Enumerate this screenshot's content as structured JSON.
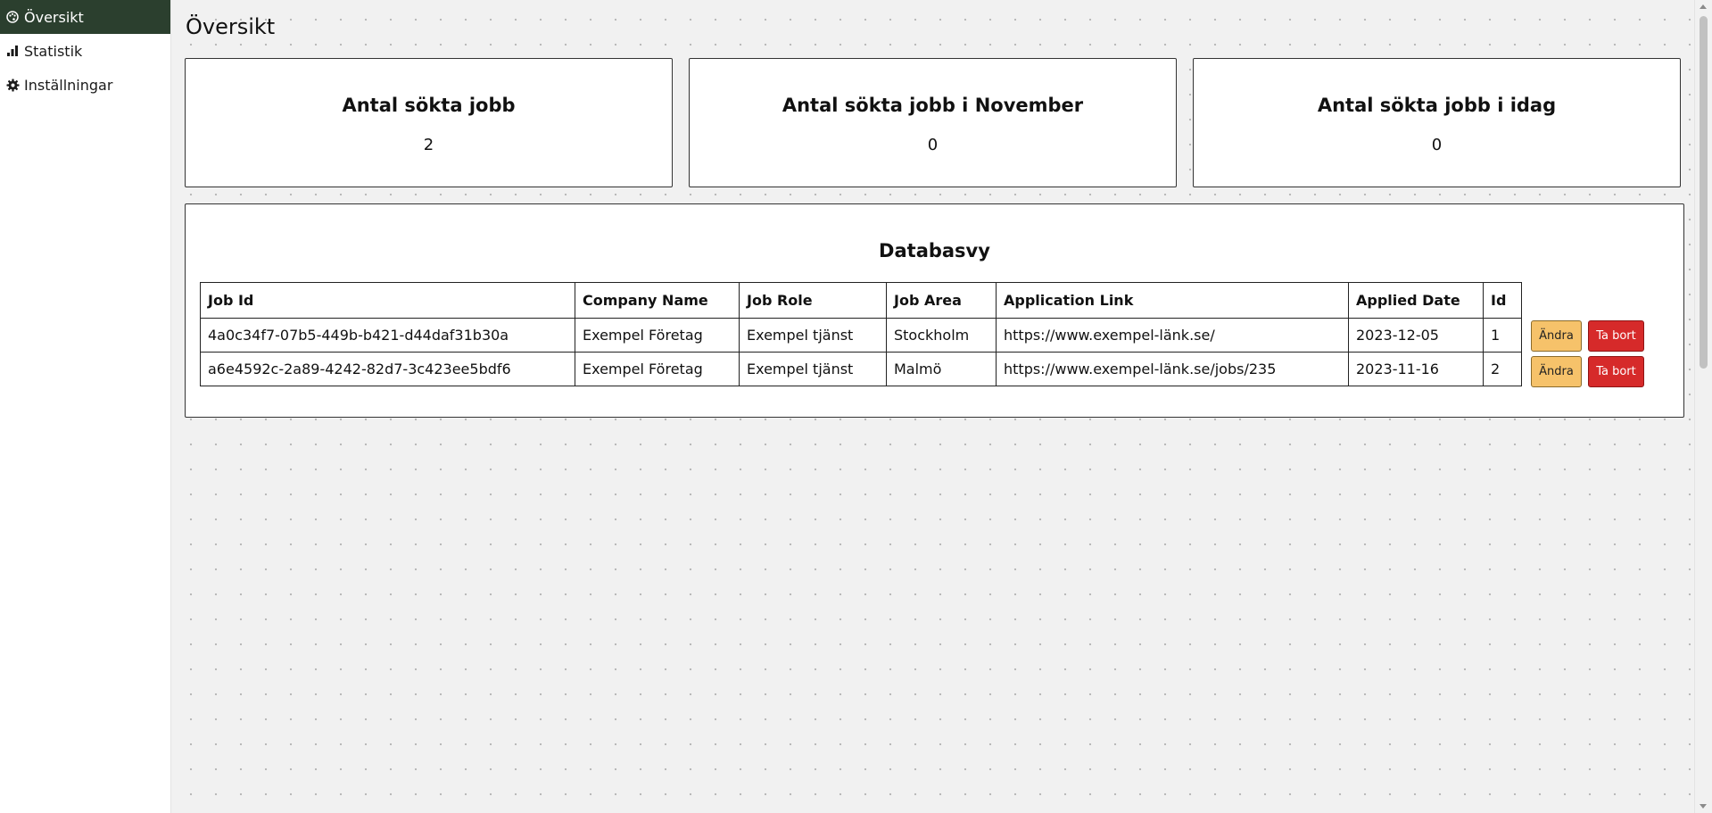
{
  "sidebar": {
    "items": [
      {
        "label": "Översikt",
        "icon": "palette-icon",
        "active": true
      },
      {
        "label": "Statistik",
        "icon": "bar-chart-icon",
        "active": false
      },
      {
        "label": "Inställningar",
        "icon": "gear-icon",
        "active": false
      }
    ]
  },
  "page": {
    "title": "Översikt"
  },
  "cards": [
    {
      "title": "Antal sökta jobb",
      "value": "2"
    },
    {
      "title": "Antal sökta jobb i November",
      "value": "0"
    },
    {
      "title": "Antal sökta jobb i idag",
      "value": "0"
    }
  ],
  "database": {
    "title": "Databasvy",
    "columns": [
      "Job Id",
      "Company Name",
      "Job Role",
      "Job Area",
      "Application Link",
      "Applied Date",
      "Id"
    ],
    "rows": [
      [
        "4a0c34f7-07b5-449b-b421-d44daf31b30a",
        "Exempel Företag",
        "Exempel tjänst",
        "Stockholm",
        "https://www.exempel-länk.se/",
        "2023-12-05",
        "1"
      ],
      [
        "a6e4592c-2a89-4242-82d7-3c423ee5bdf6",
        "Exempel Företag",
        "Exempel tjänst",
        "Malmö",
        "https://www.exempel-länk.se/jobs/235",
        "2023-11-16",
        "2"
      ]
    ],
    "edit_label": "Ändra",
    "delete_label": "Ta bort"
  },
  "colors": {
    "sidebar_active_bg": "#2b3f2e",
    "edit_button": "#f6c26a",
    "delete_button": "#d62a2a"
  }
}
